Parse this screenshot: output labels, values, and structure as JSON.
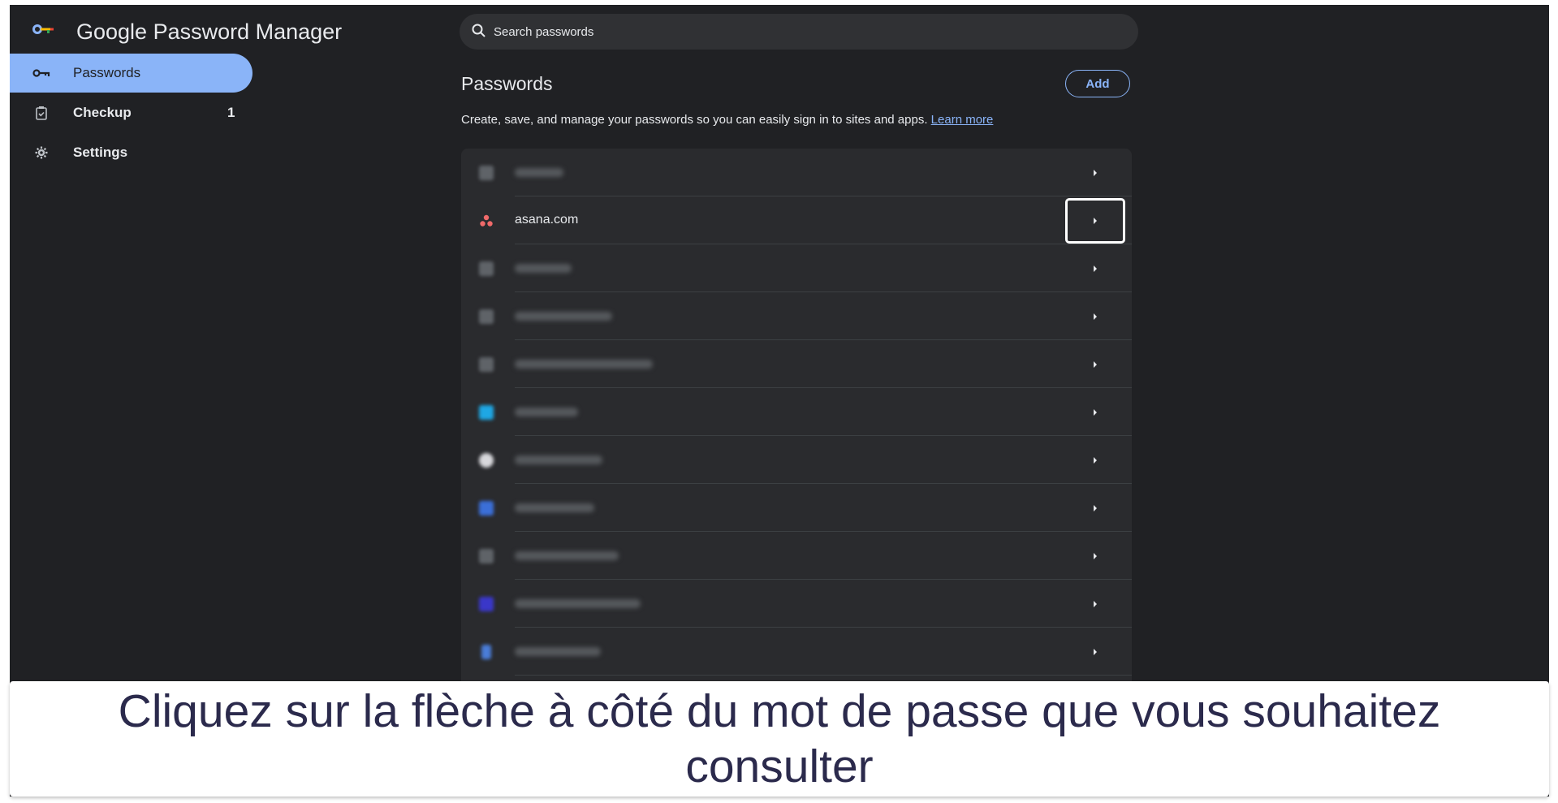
{
  "app": {
    "title": "Google Password Manager"
  },
  "sidebar": {
    "items": [
      {
        "label": "Passwords",
        "icon": "key-icon",
        "active": true
      },
      {
        "label": "Checkup",
        "icon": "clipboard-check-icon",
        "badge": "1"
      },
      {
        "label": "Settings",
        "icon": "gear-icon"
      }
    ]
  },
  "search": {
    "placeholder": "Search passwords"
  },
  "main": {
    "title": "Passwords",
    "add_label": "Add",
    "description": "Create, save, and manage your passwords so you can easily sign in to sites and apps.",
    "learn_more": "Learn more"
  },
  "rows": [
    {
      "site": "",
      "blurred": true,
      "favicon_color": "#5f6368"
    },
    {
      "site": "asana.com",
      "blurred": false,
      "favicon_color": "#f06a6a",
      "highlighted": true
    },
    {
      "site": "",
      "blurred": true,
      "favicon_color": "#5f6368"
    },
    {
      "site": "",
      "blurred": true,
      "favicon_color": "#5f6368"
    },
    {
      "site": "",
      "blurred": true,
      "favicon_color": "#5f6368"
    },
    {
      "site": "",
      "blurred": true,
      "favicon_color": "#1ea7e4"
    },
    {
      "site": "",
      "blurred": true,
      "favicon_color": "#d8d8dc"
    },
    {
      "site": "",
      "blurred": true,
      "favicon_color": "#3b6fd8"
    },
    {
      "site": "",
      "blurred": true,
      "favicon_color": "#5f6368"
    },
    {
      "site": "",
      "blurred": true,
      "favicon_color": "#3a37c9"
    },
    {
      "site": "",
      "blurred": true,
      "favicon_color": "#4a7dd8"
    }
  ],
  "caption": "Cliquez sur la flèche à côté du mot de passe que vous souhaitez consulter",
  "colors": {
    "background": "#202124",
    "accent": "#8ab4f8",
    "list": "#2a2b2e"
  }
}
